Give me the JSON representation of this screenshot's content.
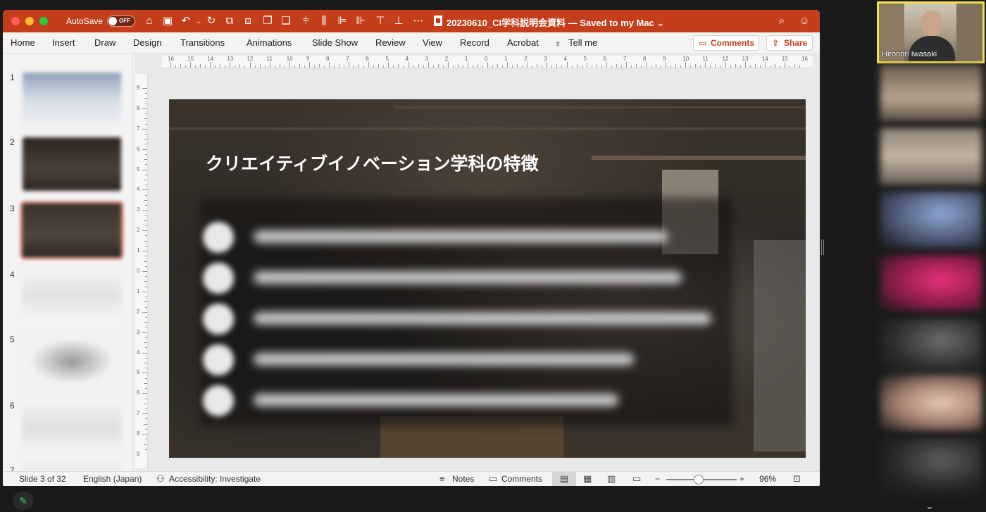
{
  "titlebar": {
    "autosave_label": "AutoSave",
    "autosave_state": "OFF",
    "document_title": "20230610_CI学科説明会資料 — Saved to my Mac ⌄"
  },
  "ribbon": {
    "tabs": [
      "Home",
      "Insert",
      "Draw",
      "Design",
      "Transitions",
      "Animations",
      "Slide Show",
      "Review",
      "View",
      "Record",
      "Acrobat"
    ],
    "tell_me": "Tell me",
    "comments_label": "Comments",
    "share_label": "Share"
  },
  "thumbnails": {
    "numbers": [
      "1",
      "2",
      "3",
      "4",
      "5",
      "6",
      "7"
    ],
    "selected_index": 3
  },
  "ruler": {
    "horizontal": [
      "16",
      "15",
      "14",
      "13",
      "12",
      "11",
      "10",
      "9",
      "8",
      "7",
      "6",
      "5",
      "4",
      "3",
      "2",
      "1",
      "0",
      "1",
      "2",
      "3",
      "4",
      "5",
      "6",
      "7",
      "8",
      "9",
      "10",
      "11",
      "12",
      "13",
      "14",
      "15",
      "16"
    ],
    "vertical": [
      "9",
      "8",
      "7",
      "6",
      "5",
      "4",
      "3",
      "2",
      "1",
      "0",
      "1",
      "2",
      "3",
      "4",
      "5",
      "6",
      "7",
      "8",
      "9"
    ]
  },
  "slide": {
    "title": "クリエイティブイノベーション学科の特徴"
  },
  "statusbar": {
    "slide_position": "Slide 3 of 32",
    "language": "English (Japan)",
    "accessibility": "Accessibility: Investigate",
    "notes": "Notes",
    "comments": "Comments",
    "zoom_minus": "−",
    "zoom_plus": "+",
    "zoom_level": "96%"
  },
  "zoom_meeting": {
    "active_speaker_name": "Hironori Iwasaki"
  },
  "colors": {
    "ppt_accent": "#c43e1c",
    "speaker_highlight": "#f2e04f"
  }
}
